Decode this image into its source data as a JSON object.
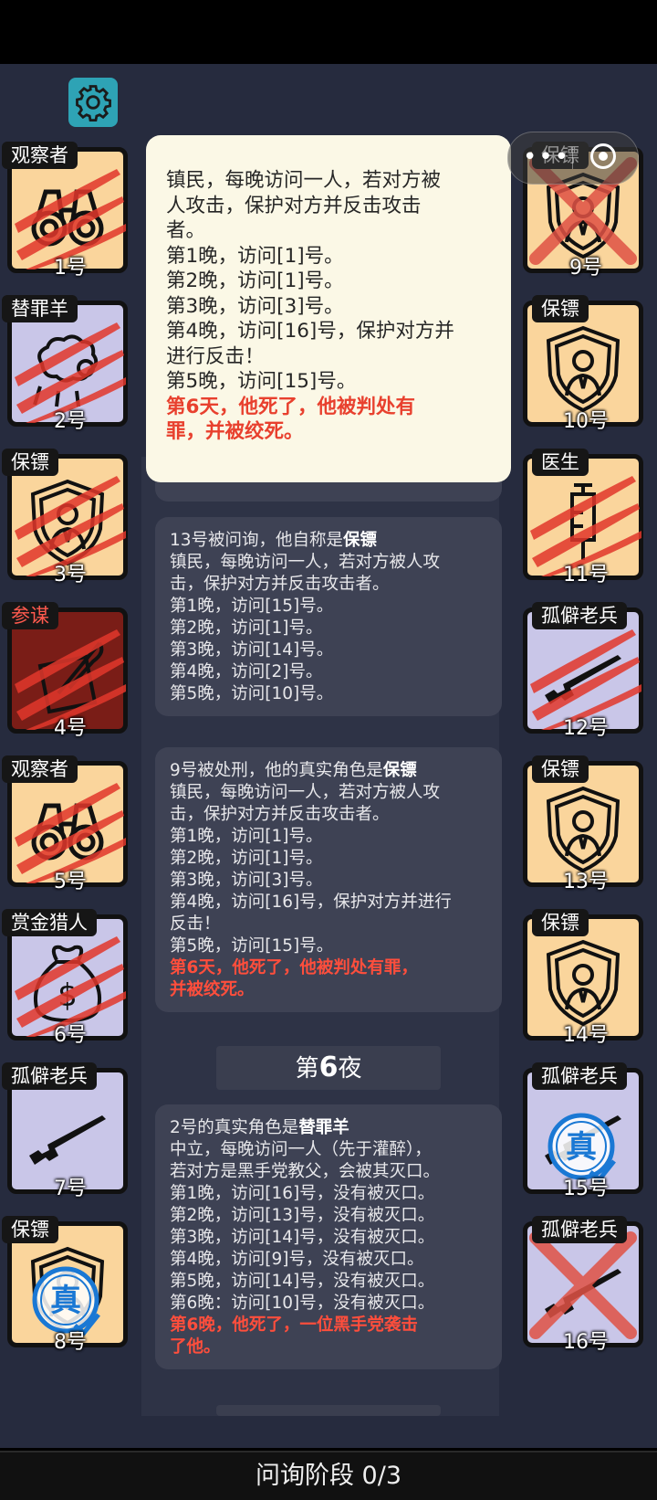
{
  "status_bar": {},
  "settings": {
    "icon": "gear-icon"
  },
  "players": [
    {
      "num": "1号",
      "role": "观察者",
      "icon": "binoculars-icon",
      "bg": "#fad59c",
      "claw": true
    },
    {
      "num": "2号",
      "role": "替罪羊",
      "icon": "sheep-icon",
      "bg": "#c9c6e8",
      "claw": true
    },
    {
      "num": "3号",
      "role": "保镖",
      "icon": "shield-person-icon",
      "bg": "#fad59c",
      "claw": true
    },
    {
      "num": "4号",
      "role": "参谋",
      "icon": "quill-paper-icon",
      "bg": "#7a1d17",
      "claw": true
    },
    {
      "num": "5号",
      "role": "观察者",
      "icon": "binoculars-icon",
      "bg": "#fad59c",
      "claw": true
    },
    {
      "num": "6号",
      "role": "赏金猎人",
      "icon": "money-bag-icon",
      "bg": "#c9c6e8",
      "claw": true
    },
    {
      "num": "7号",
      "role": "孤僻老兵",
      "icon": "rifle-icon",
      "bg": "#c9c6e8"
    },
    {
      "num": "8号",
      "role": "保镖",
      "icon": "shield-person-icon",
      "bg": "#fad59c",
      "stamp": "真"
    },
    {
      "num": "9号",
      "role": "保镖",
      "icon": "shield-person-icon",
      "bg": "#fad59c",
      "x": true
    },
    {
      "num": "10号",
      "role": "保镖",
      "icon": "shield-person-icon",
      "bg": "#fad59c"
    },
    {
      "num": "11号",
      "role": "医生",
      "icon": "syringe-icon",
      "bg": "#fad59c",
      "claw": true
    },
    {
      "num": "12号",
      "role": "孤僻老兵",
      "icon": "rifle-icon",
      "bg": "#c9c6e8",
      "claw": true
    },
    {
      "num": "13号",
      "role": "保镖",
      "icon": "shield-person-icon",
      "bg": "#fad59c"
    },
    {
      "num": "14号",
      "role": "保镖",
      "icon": "shield-person-icon",
      "bg": "#fad59c"
    },
    {
      "num": "15号",
      "role": "孤僻老兵",
      "icon": "rifle-icon",
      "bg": "#c9c6e8",
      "stamp": "真"
    },
    {
      "num": "16号",
      "role": "孤僻老兵",
      "icon": "rifle-icon",
      "bg": "#c9c6e8",
      "x": true
    }
  ],
  "tooltip": {
    "lines": [
      "镇民，每晚访问一人，若对方被",
      "人攻击，保护对方并反击攻击",
      "者。",
      "第1晚，访问[1]号。",
      "第2晚，访问[1]号。",
      "第3晚，访问[3]号。",
      "第4晚，访问[16]号，保护对方并",
      "进行反击！",
      "第5晚，访问[15]号。"
    ],
    "death": [
      "第6天，他死了，他被判处有",
      "罪，并被绞死。"
    ]
  },
  "log": [
    {
      "head_pre": "13号被问询，他自称是",
      "head_role": "保镖",
      "lines": [
        "镇民，每晚访问一人，若对方被人攻",
        "击，保护对方并反击攻击者。",
        "第1晚，访问[15]号。",
        "第2晚，访问[1]号。",
        "第3晚，访问[14]号。",
        "第4晚，访问[2]号。",
        "第5晚，访问[10]号。"
      ],
      "death": []
    },
    {
      "head_pre": "9号被处刑，他的真实角色是",
      "head_role": "保镖",
      "lines": [
        "镇民，每晚访问一人，若对方被人攻",
        "击，保护对方并反击攻击者。",
        "第1晚，访问[1]号。",
        "第2晚，访问[1]号。",
        "第3晚，访问[3]号。",
        "第4晚，访问[16]号，保护对方并进行",
        "反击！",
        "第5晚，访问[15]号。"
      ],
      "death": [
        "第6天，他死了，他被判处有罪，",
        "并被绞死。"
      ]
    },
    {
      "head_pre": "2号的真实角色是",
      "head_role": "替罪羊",
      "lines": [
        "中立，每晚访问一人（先于灌醉），",
        "若对方是黑手党教父，会被其灭口。",
        "第1晚，访问[16]号，没有被灭口。",
        "第2晚，访问[13]号，没有被灭口。",
        "第3晚，访问[14]号，没有被灭口。",
        "第4晚，访问[9]号，没有被灭口。",
        "第5晚，访问[14]号，没有被灭口。",
        "第6晚：访问[10]号，没有被灭口。"
      ],
      "death": [
        "第6晚，他死了，一位黑手党袭击",
        "了他。"
      ]
    }
  ],
  "night_label": {
    "pre": "第",
    "num": "6",
    "post": "夜"
  },
  "phase": "问询阶段 0/3"
}
